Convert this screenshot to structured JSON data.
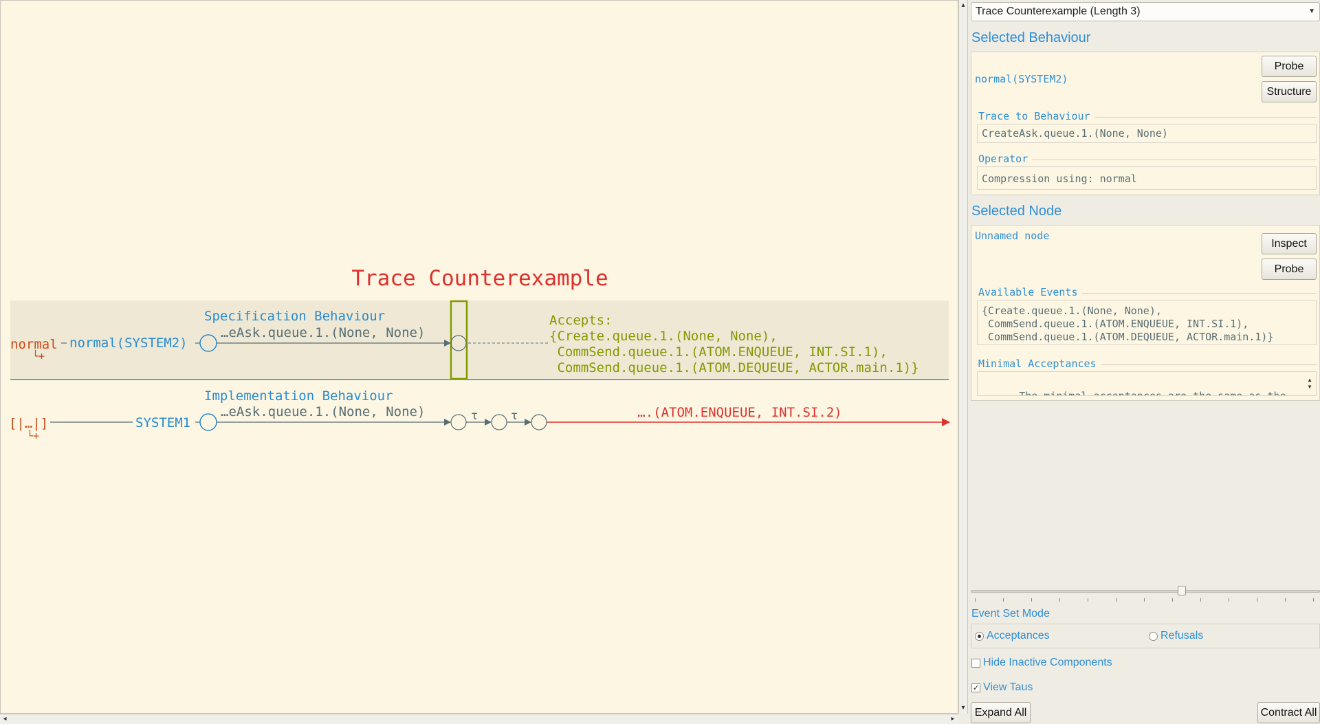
{
  "canvas": {
    "title": "Trace Counterexample",
    "spec": {
      "heading": "Specification Behaviour",
      "left_operator": "normal",
      "left_expand": "└+",
      "process": "normal(SYSTEM2)",
      "trace_label": "…eAsk.queue.1.(None, None)",
      "accepts_title": "Accepts:",
      "accepts_lines": [
        "{Create.queue.1.(None, None),",
        " CommSend.queue.1.(ATOM.ENQUEUE, INT.SI.1),",
        " CommSend.queue.1.(ATOM.DEQUEUE, ACTOR.main.1)}"
      ]
    },
    "impl": {
      "heading": "Implementation Behaviour",
      "left_operator": "[|…|]",
      "left_expand": "└+",
      "process": "SYSTEM1",
      "trace_label": "…eAsk.queue.1.(None, None)",
      "tau1": "τ",
      "tau2": "τ",
      "error_event": "….(ATOM.ENQUEUE, INT.SI.2)"
    },
    "colors": {
      "red": "#dc322f",
      "blue": "#268bd2",
      "olive": "#859900",
      "grey": "#586e75",
      "orange": "#cb4b16"
    }
  },
  "panel": {
    "dropdown": "Trace Counterexample (Length 3)",
    "selected_behaviour": {
      "title": "Selected Behaviour",
      "name": "normal(SYSTEM2)",
      "probe": "Probe",
      "structure": "Structure",
      "trace_label": "Trace to Behaviour",
      "trace_value": "CreateAsk.queue.1.(None, None)",
      "operator_label": "Operator",
      "operator_value": "Compression using: normal"
    },
    "selected_node": {
      "title": "Selected Node",
      "name": "Unnamed node",
      "inspect": "Inspect",
      "probe": "Probe",
      "events_label": "Available Events",
      "events_lines": [
        "{Create.queue.1.(None, None),",
        " CommSend.queue.1.(ATOM.ENQUEUE, INT.SI.1),",
        " CommSend.queue.1.(ATOM.DEQUEUE, ACTOR.main.1)}"
      ],
      "minimal_label": "Minimal Acceptances",
      "minimal_value": "The minimal acceptances are the same as the"
    },
    "event_set_mode": {
      "label": "Event Set Mode",
      "acceptances": "Acceptances",
      "refusals": "Refusals",
      "selected": "Acceptances"
    },
    "hide_inactive": {
      "label": "Hide Inactive Components",
      "checked": false
    },
    "view_taus": {
      "label": "View Taus",
      "checked": true
    },
    "expand_all": "Expand All",
    "contract_all": "Contract All",
    "slider_value": 0.6
  }
}
